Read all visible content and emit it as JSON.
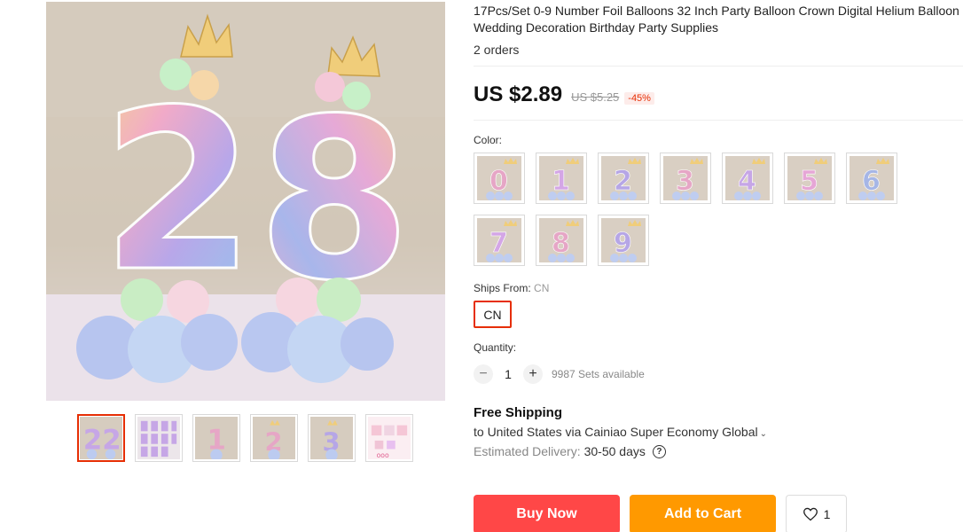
{
  "product": {
    "title": "17Pcs/Set 0-9 Number Foil Balloons 32 Inch Party Balloon Crown Digital Helium Balloon Wedding Decoration Birthday Party Supplies",
    "orders": "2 orders"
  },
  "gallery": {
    "main_digits": "28",
    "thumbnails": [
      {
        "digits": "22"
      },
      {
        "digits": "grid"
      },
      {
        "digits": "1"
      },
      {
        "digits": "2"
      },
      {
        "digits": "3"
      },
      {
        "digits": "collage"
      }
    ]
  },
  "price": {
    "current": "US $2.89",
    "original": "US $5.25",
    "discount": "-45%"
  },
  "color": {
    "label": "Color:",
    "options": [
      "0",
      "1",
      "2",
      "3",
      "4",
      "5",
      "6",
      "7",
      "8",
      "9"
    ]
  },
  "ships_from": {
    "label": "Ships From:",
    "value": "CN",
    "option": "CN"
  },
  "quantity": {
    "label": "Quantity:",
    "minus": "−",
    "plus": "+",
    "value": "1",
    "available": "9987 Sets available"
  },
  "shipping": {
    "title": "Free Shipping",
    "to": "to United States via Cainiao Super Economy Global",
    "chevron": "⌄",
    "delivery_label": "Estimated Delivery:",
    "delivery_days": "30-50 days",
    "help": "?"
  },
  "actions": {
    "buy_now": "Buy Now",
    "add_to_cart": "Add to Cart",
    "wishlist_count": "1"
  },
  "colors": {
    "accent": "#e62e04",
    "buy": "#ff4747",
    "cart": "#ff9900"
  }
}
